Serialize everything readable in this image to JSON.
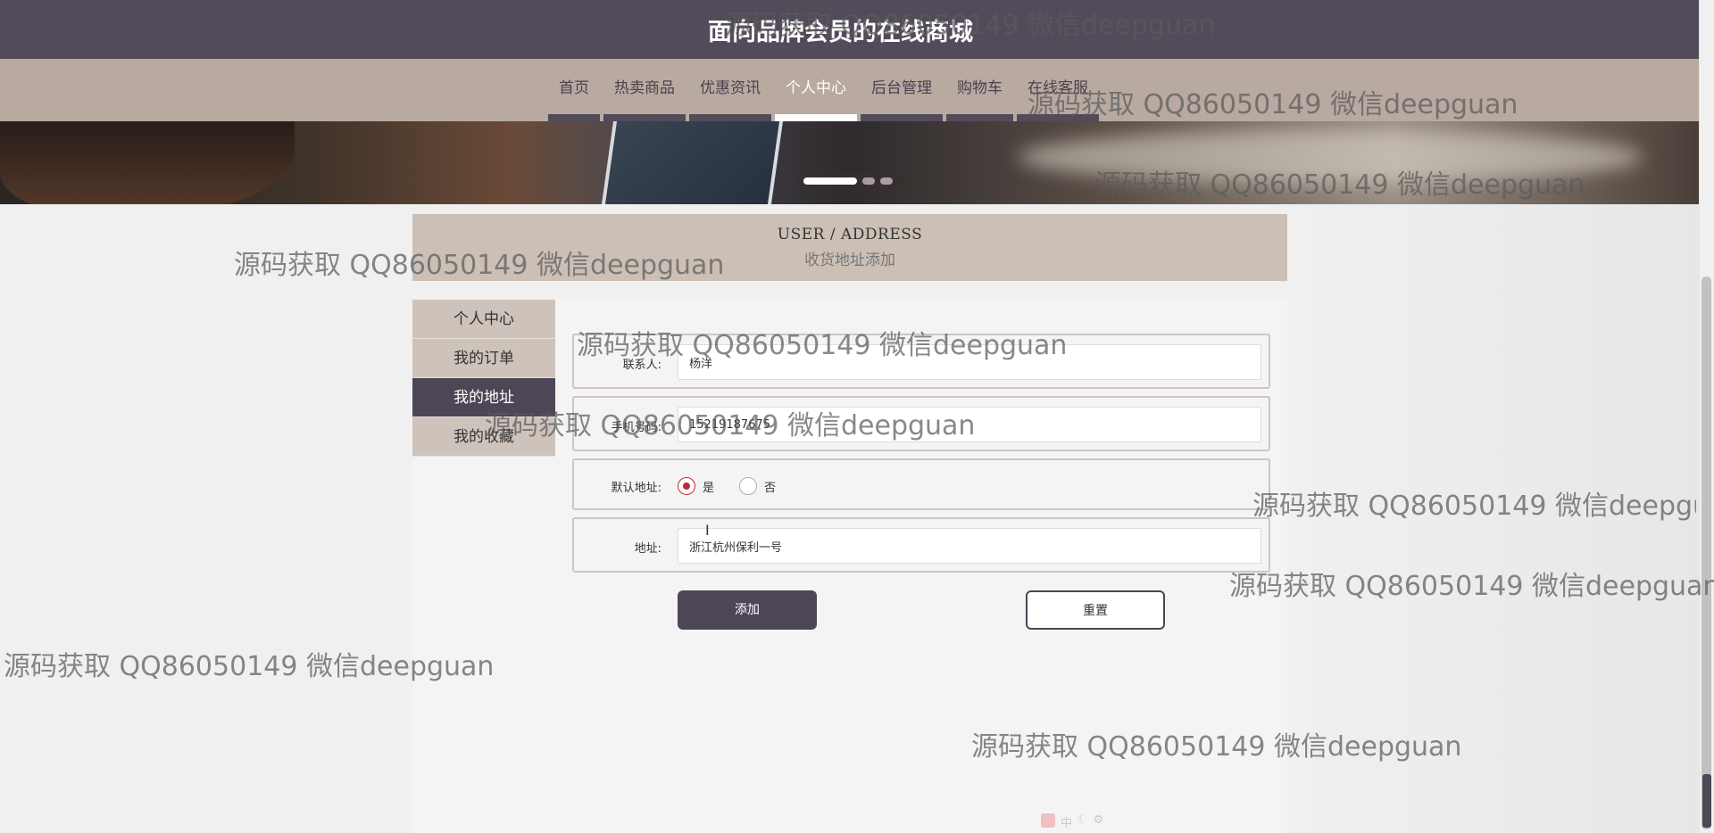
{
  "site": {
    "title": "面向品牌会员的在线商城"
  },
  "nav": {
    "items": [
      {
        "label": "首页"
      },
      {
        "label": "热卖商品"
      },
      {
        "label": "优惠资讯"
      },
      {
        "label": "个人中心",
        "active": true
      },
      {
        "label": "后台管理"
      },
      {
        "label": "购物车"
      },
      {
        "label": "在线客服"
      }
    ]
  },
  "banner": {
    "slide_count": 3,
    "active_slide": 1
  },
  "page_header": {
    "en": "USER / ADDRESS",
    "cn": "收货地址添加"
  },
  "sidebar": {
    "items": [
      {
        "label": "个人中心"
      },
      {
        "label": "我的订单"
      },
      {
        "label": "我的地址",
        "active": true
      },
      {
        "label": "我的收藏"
      }
    ]
  },
  "form": {
    "contact": {
      "label": "联系人:",
      "value": "杨洋"
    },
    "phone": {
      "label": "手机号码:",
      "value": "15219187675"
    },
    "default_address": {
      "label": "默认地址:",
      "options": [
        {
          "label": "是",
          "checked": true
        },
        {
          "label": "否",
          "checked": false
        }
      ]
    },
    "address": {
      "label": "地址:",
      "value": "浙江杭州保利一号"
    },
    "submit_label": "添加",
    "reset_label": "重置"
  },
  "watermark": {
    "text": "源码获取 QQ86050149 微信deepguan"
  },
  "ime_toolbar": {
    "label": "中"
  },
  "colors": {
    "header_bg": "#524b5a",
    "nav_bg": "#b8aaa0",
    "accent_dark": "#4d4656",
    "sidebar_bg": "#cec3ba",
    "radio_checked": "#c0282f"
  }
}
